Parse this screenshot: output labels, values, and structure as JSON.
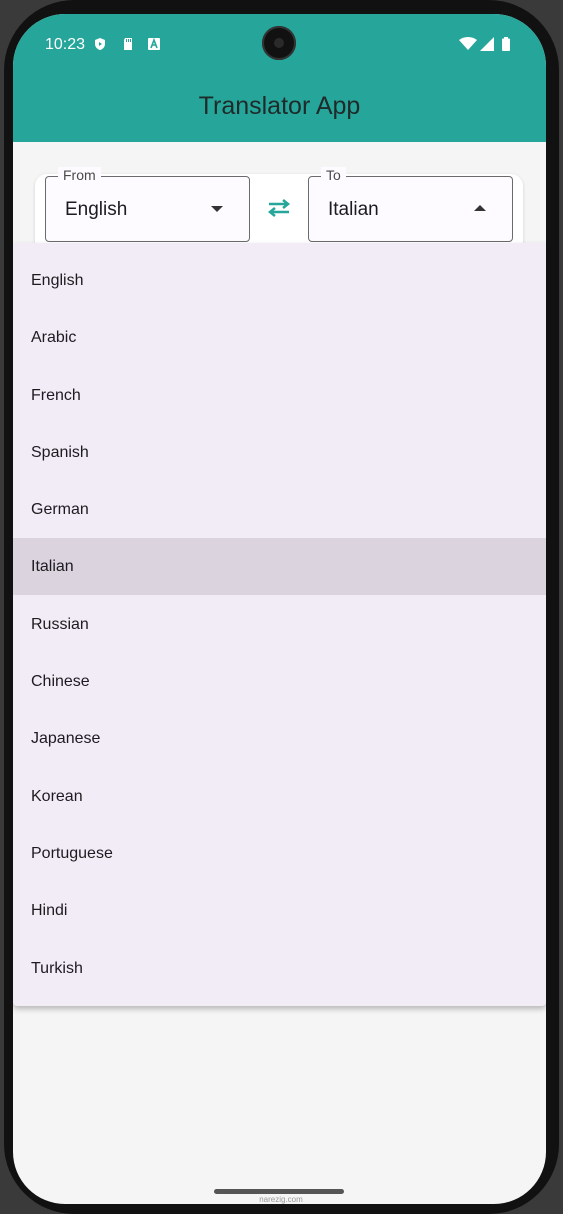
{
  "status_bar": {
    "time": "10:23"
  },
  "app_bar": {
    "title": "Translator App",
    "color": "#26a69a"
  },
  "from_field": {
    "label": "From",
    "value": "English"
  },
  "to_field": {
    "label": "To",
    "value": "Italian"
  },
  "menu": {
    "items": [
      {
        "label": "English"
      },
      {
        "label": "Arabic"
      },
      {
        "label": "French"
      },
      {
        "label": "Spanish"
      },
      {
        "label": "German"
      },
      {
        "label": "Italian",
        "selected": true
      },
      {
        "label": "Russian"
      },
      {
        "label": "Chinese"
      },
      {
        "label": "Japanese"
      },
      {
        "label": "Korean"
      },
      {
        "label": "Portuguese"
      },
      {
        "label": "Hindi"
      },
      {
        "label": "Turkish"
      }
    ]
  },
  "watermark": "narezig.com"
}
